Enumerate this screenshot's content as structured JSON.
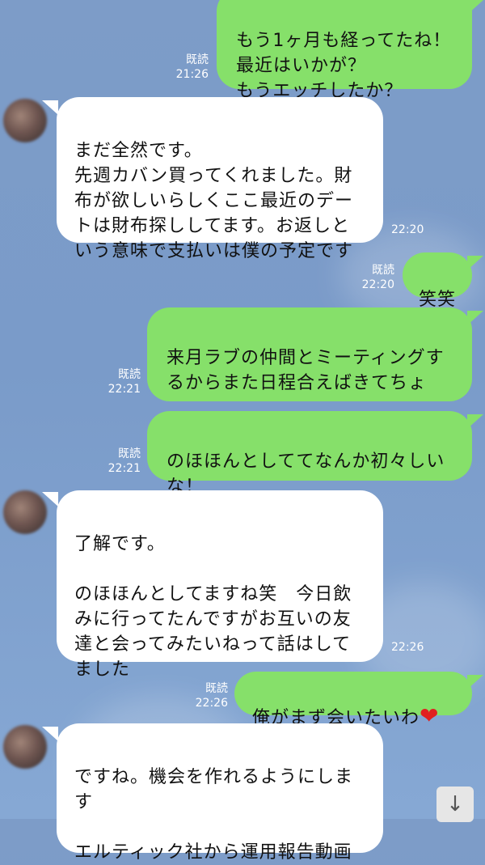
{
  "messages": [
    {
      "side": "out",
      "text": "もう1ヶ月も経ってたね！\n最近はいかが？\nもうエッチしたか？",
      "read": "既読",
      "time": "21:26"
    },
    {
      "side": "in",
      "text": "まだ全然です。\n先週カバン買ってくれました。財\n布が欲しいらしくここ最近のデー\nトは財布探ししてます。お返しと\nいう意味で支払いは僕の予定です",
      "time": "22:20"
    },
    {
      "side": "out",
      "text": "笑笑",
      "read": "既読",
      "time": "22:20"
    },
    {
      "side": "out",
      "text": "来月ラブの仲間とミーティングす\nるからまた日程合えばきてちょ",
      "emoji": "👍",
      "read": "既読",
      "time": "22:21"
    },
    {
      "side": "out",
      "text": "のほほんとしててなんか初々しい\nな！",
      "read": "既読",
      "time": "22:21"
    },
    {
      "side": "in",
      "text": "了解です。\n\nのほほんとしてますね笑　今日飲\nみに行ってたんですがお互いの友\n達と会ってみたいねって話はして\nました",
      "time": "22:26"
    },
    {
      "side": "out",
      "text": "俺がまず会いたいわ",
      "emoji": "❤",
      "read": "既読",
      "time": "22:26"
    },
    {
      "side": "in",
      "text": "ですね。機会を作れるようにしま\nす\n\nエルティック社から運用報告動画"
    }
  ],
  "scroll_button": {
    "icon": "arrow-down-icon",
    "glyph": "↓"
  }
}
